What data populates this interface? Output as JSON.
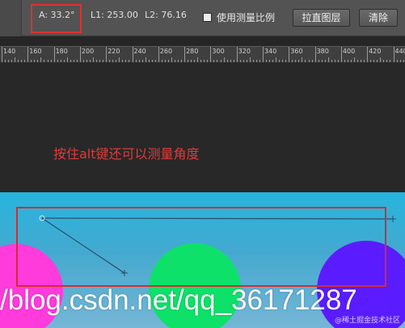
{
  "options_bar": {
    "angle": "A: 33.2°",
    "length1": "L1: 253.00",
    "length2": "L2: 76.16",
    "use_scale_label": "使用测量比例",
    "straighten_button": "拉直图层",
    "clear_button": "清除"
  },
  "ruler": {
    "labels": [
      "140",
      "160",
      "180",
      "200",
      "220",
      "240",
      "260",
      "280",
      "300",
      "320",
      "340",
      "360",
      "380",
      "400",
      "420",
      "440"
    ]
  },
  "annotation": {
    "text": "按住alt键还可以测量角度"
  },
  "canvas": {
    "circle_colors": [
      "#ff3bdc",
      "#0ee169",
      "#5a1cff"
    ]
  },
  "watermark": {
    "url_text": "/blog.csdn.net/qq_36171287",
    "credit_text": "@稀土掘金技术社区"
  },
  "colors": {
    "highlight": "#e03030",
    "annotation": "#e03a3a",
    "measure_line": "#2a4c6c"
  }
}
